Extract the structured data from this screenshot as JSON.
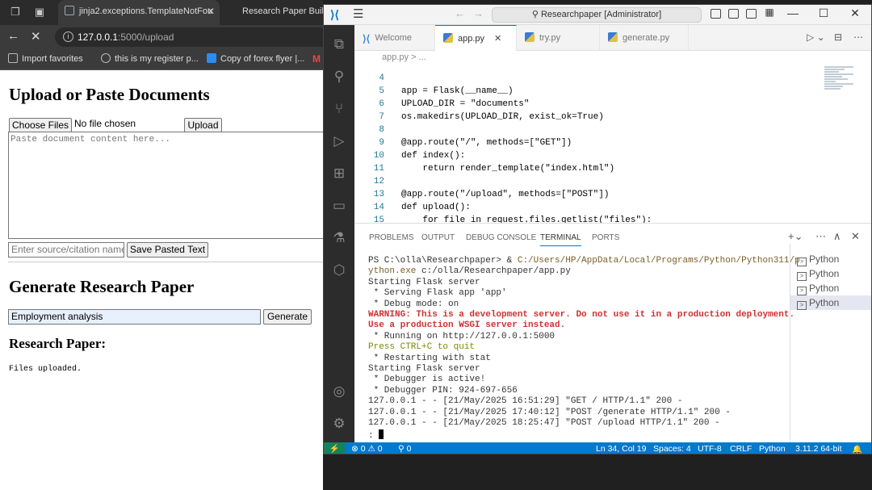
{
  "browser": {
    "tabs": [
      {
        "title": "jinja2.exceptions.TemplateNotFou",
        "close": "✕"
      },
      {
        "title": "Research Paper Builder"
      }
    ],
    "address": {
      "host": "127.0.0.1",
      "path": ":5000/upload"
    },
    "bookmarks": [
      {
        "label": "Import favorites"
      },
      {
        "label": "this is my register p..."
      },
      {
        "label": "Copy of forex flyer |..."
      },
      {
        "label": "M"
      }
    ]
  },
  "page": {
    "heading_upload": "Upload or Paste Documents",
    "choose_files": "Choose Files",
    "no_file": "No file chosen",
    "upload_button": "Upload",
    "paste_placeholder": "Paste document content here...",
    "source_placeholder": "Enter source/citation name",
    "save_button": "Save Pasted Text",
    "heading_generate": "Generate Research Paper",
    "topic_value": "Employment analysis",
    "generate_button": "Generate",
    "heading_paper": "Research Paper:",
    "status_text": "Files uploaded."
  },
  "vscode": {
    "command_center": "Researchpaper [Administrator]",
    "tabs": [
      {
        "label": "Welcome",
        "active": false
      },
      {
        "label": "app.py",
        "active": true,
        "close": "✕"
      },
      {
        "label": "try.py",
        "active": false
      },
      {
        "label": "generate.py",
        "active": false
      }
    ],
    "breadcrumb": "app.py > ...",
    "line_numbers": [
      "4",
      "5",
      "6",
      "7",
      "8",
      "9",
      "10",
      "11",
      "12",
      "13",
      "14",
      "15"
    ],
    "code_lines": [
      "",
      "app = Flask(__name__)",
      "UPLOAD_DIR = \"documents\"",
      "os.makedirs(UPLOAD_DIR, exist_ok=True)",
      "",
      "@app.route(\"/\", methods=[\"GET\"])",
      "def index():",
      "    return render_template(\"index.html\")",
      "",
      "@app.route(\"/upload\", methods=[\"POST\"])",
      "def upload():",
      "    for file in request.files.getlist(\"files\"):"
    ],
    "panel_tabs": [
      "PROBLEMS",
      "OUTPUT",
      "DEBUG CONSOLE",
      "TERMINAL",
      "PORTS"
    ],
    "active_panel_tab": "TERMINAL",
    "terminal_lines": [
      {
        "text": "PS C:\\olla\\Researchpaper> & ",
        "cls": ""
      },
      {
        "text": " * Serving Flask app 'app'",
        "cls": ""
      }
    ],
    "terminal": {
      "prompt": "PS C:\\olla\\Researchpaper> & ",
      "python_path": "C:/Users/HP/AppData/Local/Programs/Python/Python311/p",
      "python_path2": "ython.exe",
      "script": " c:/olla/Researchpaper/app.py",
      "l3": "Starting Flask server",
      "l4": " * Serving Flask app 'app'",
      "l5": " * Debug mode: on",
      "l6": "WARNING: This is a development server. Do not use it in a production deployment.",
      "l7": "Use a production WSGI server instead.",
      "l8": " * Running on http://127.0.0.1:5000",
      "l9": "Press CTRL+C to quit",
      "l10": " * Restarting with stat",
      "l11": "Starting Flask server",
      "l12": " * Debugger is active!",
      "l13": " * Debugger PIN: 924-697-656",
      "l14": "127.0.0.1 - - [21/May/2025 16:51:29] \"GET / HTTP/1.1\" 200 -",
      "l15": "127.0.0.1 - - [21/May/2025 17:40:12] \"POST /generate HTTP/1.1\" 200 -",
      "l16": "127.0.0.1 - - [21/May/2025 18:25:47] \"POST /upload HTTP/1.1\" 200 -",
      "l17": ":"
    },
    "terminal_list": [
      "Python",
      "Python",
      "Python",
      "Python"
    ],
    "status": {
      "remote": "⚡",
      "errors": "⊗ 0 ⚠ 0",
      "ports": "⚲ 0",
      "position": "Ln 34, Col 19",
      "spaces": "Spaces: 4",
      "encoding": "UTF-8",
      "eol": "CRLF",
      "language": "Python",
      "interpreter": "3.11.2 64-bit"
    },
    "colors": {
      "accent": "#007acc",
      "remote": "#16825d",
      "warning": "#cd3131"
    }
  }
}
